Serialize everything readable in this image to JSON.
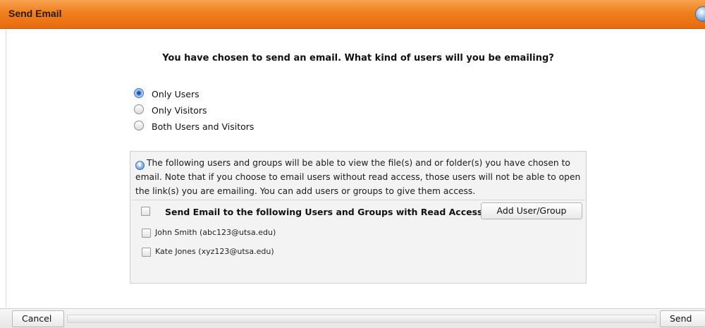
{
  "dialog": {
    "title": "Send Email",
    "question": "You have chosen to send an email. What kind of users will you be emailing?"
  },
  "recipient_type": {
    "selected": "Only Users",
    "options": [
      {
        "label": "Only Users",
        "checked": true
      },
      {
        "label": "Only Visitors",
        "checked": false
      },
      {
        "label": "Both Users and Visitors",
        "checked": false
      }
    ]
  },
  "access_panel": {
    "info_icon": "info-icon",
    "info_text": "The following users and groups will be able to view the file(s) and or folder(s) you have chosen to email. Note that if you choose to email users without read access, those users will not be able to open the link(s) you are emailing. You can add users or groups to give them access.",
    "header_label": "Send Email to the following Users and Groups with Read Access",
    "add_button_label": "Add User/Group",
    "members": [
      {
        "label": "John Smith (abc123@utsa.edu)",
        "checked": false
      },
      {
        "label": "Kate Jones (xyz123@utsa.edu)",
        "checked": false
      }
    ]
  },
  "footer": {
    "cancel_label": "Cancel",
    "send_label": "Send"
  },
  "colors": {
    "titlebar": "#ef7f1e",
    "panel_background": "#f3f3f3",
    "radio_selected": "#3a6fb7"
  }
}
